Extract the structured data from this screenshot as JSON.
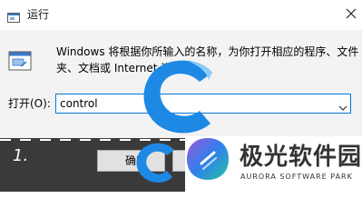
{
  "window": {
    "title": "运行",
    "close_glyph": "✕"
  },
  "dialog": {
    "description_line1": "Windows 将根据你所输入的名称，为你打开相应的程序、文件",
    "description_line2": "夹、文档或 Internet 资源。",
    "open_label": "打开(O):",
    "open_value": "control",
    "ok_label": "确定"
  },
  "overlay": {
    "step_number": "1.",
    "brand_name": "极光软件园",
    "brand_subtitle": "AURORA SOFTWARE PARK"
  },
  "icons": {
    "title": "run-icon",
    "body": "run-icon",
    "close": "close-icon",
    "dropdown": "chevron-down-icon"
  },
  "colors": {
    "accent": "#0078d7",
    "logo_blue": "#1e88e5",
    "logo_light": "#8ecdf5",
    "brand_text": "#333333"
  }
}
